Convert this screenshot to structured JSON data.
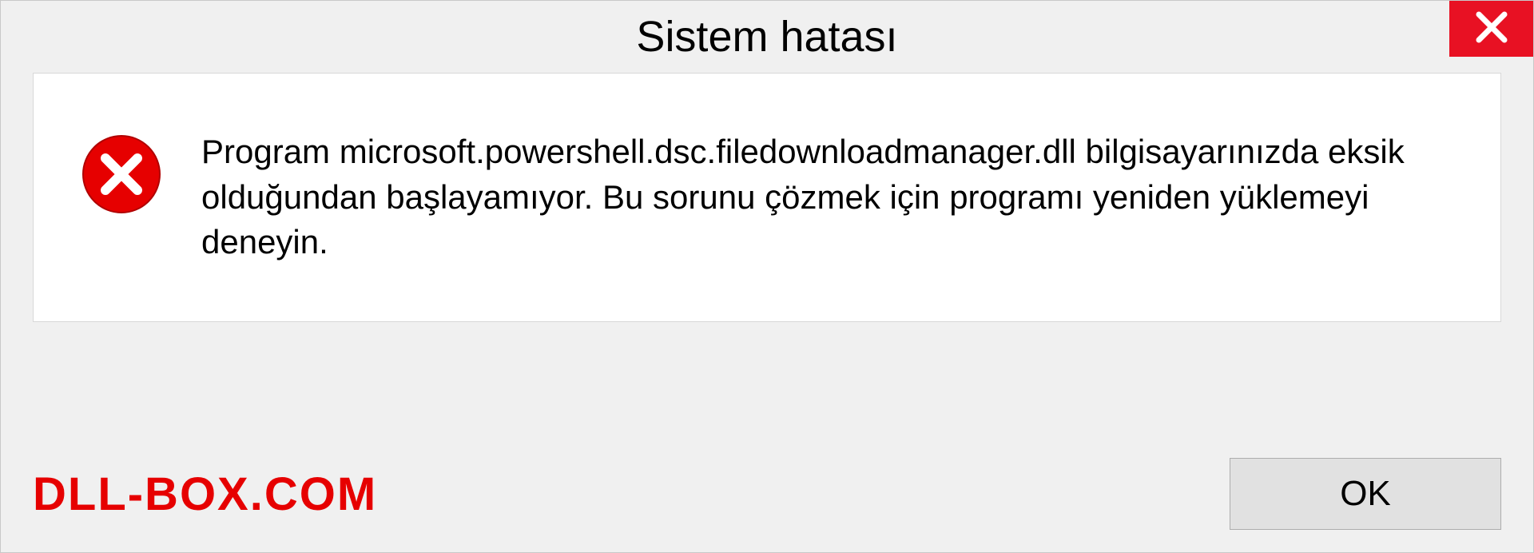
{
  "dialog": {
    "title": "Sistem hatası",
    "message": "Program microsoft.powershell.dsc.filedownloadmanager.dll bilgisayarınızda eksik olduğundan başlayamıyor. Bu sorunu çözmek için programı yeniden yüklemeyi deneyin.",
    "ok_label": "OK"
  },
  "watermark": "DLL-BOX.COM",
  "colors": {
    "close_bg": "#e81123",
    "watermark": "#e60000"
  }
}
